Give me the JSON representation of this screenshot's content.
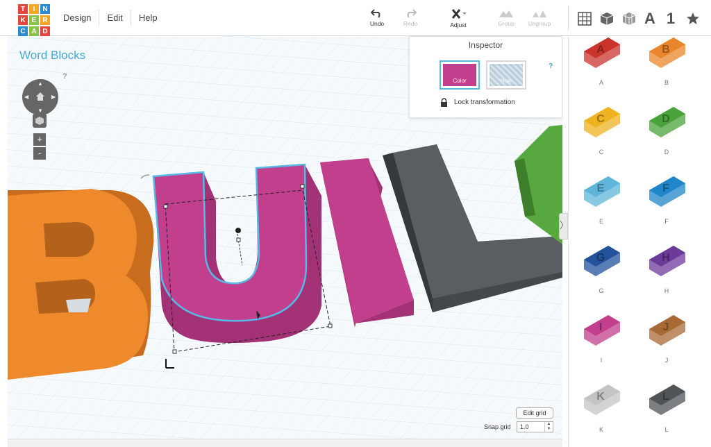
{
  "app": {
    "logo_letters": [
      "T",
      "I",
      "N",
      "K",
      "E",
      "R",
      "C",
      "A",
      "D"
    ],
    "logo_colors": [
      "#e4463b",
      "#f5a623",
      "#2a8bd3",
      "#e4463b",
      "#8ac24a",
      "#f5a623",
      "#2a8bd3",
      "#8ac24a",
      "#e4463b"
    ]
  },
  "menu": {
    "design": "Design",
    "edit": "Edit",
    "help": "Help"
  },
  "toolbar": {
    "undo": "Undo",
    "redo": "Redo",
    "adjust": "Adjust",
    "group": "Group",
    "ungroup": "Ungroup"
  },
  "view_buttons": {
    "text_tool": "A",
    "number_tool": "1"
  },
  "project": {
    "title": "Word Blocks",
    "help": "?"
  },
  "workplane": {
    "edit_grid": "Edit grid",
    "snap_grid_label": "Snap grid",
    "snap_grid_value": "1.0",
    "zoom_in": "+",
    "zoom_out": "-"
  },
  "inspector": {
    "title": "Inspector",
    "color_label": "Color",
    "hole_label": "Hole",
    "help": "?",
    "lock_label": "Lock transformation",
    "selected_color": "#c13f8c"
  },
  "panel": {
    "toggle": "〉",
    "letters": [
      {
        "label": "A",
        "color": "#c9342b"
      },
      {
        "label": "B",
        "color": "#e9862b"
      },
      {
        "label": "C",
        "color": "#eeb321"
      },
      {
        "label": "D",
        "color": "#4aa33a"
      },
      {
        "label": "E",
        "color": "#5fb5d9"
      },
      {
        "label": "F",
        "color": "#1f86c9"
      },
      {
        "label": "G",
        "color": "#22529c"
      },
      {
        "label": "H",
        "color": "#6c3a99"
      },
      {
        "label": "I",
        "color": "#c13f8c"
      },
      {
        "label": "J",
        "color": "#a86a35"
      },
      {
        "label": "K",
        "color": "#c4c4c4"
      },
      {
        "label": "L",
        "color": "#505457"
      }
    ]
  },
  "colors": {
    "b_orange": "#ee8a2b",
    "u_magenta": "#c13f8c",
    "l_grey": "#5a5e62",
    "green": "#57a83e",
    "accent": "#46a8d8"
  }
}
